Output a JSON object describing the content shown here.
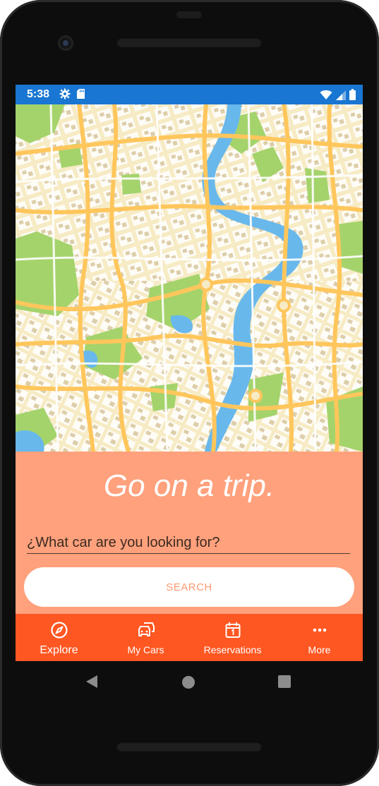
{
  "status_bar": {
    "time": "5:38",
    "background": "#1976d2",
    "icons_left": [
      "gear-icon",
      "sd-card-icon"
    ],
    "icons_right": [
      "wifi-icon",
      "cellular-signal-icon",
      "battery-icon"
    ]
  },
  "map": {
    "colors": {
      "land": "#f6ebc4",
      "park": "#a4d36c",
      "water": "#69b8ec",
      "road": "#ffc65c",
      "building": "#d9c9a6"
    }
  },
  "hero": {
    "title": "Go on a trip.",
    "background": "#ffa17c",
    "search": {
      "placeholder": "¿What car are you looking for?",
      "value": ""
    },
    "button_label": "SEARCH"
  },
  "bottom_nav": {
    "background": "#ff5722",
    "items": [
      {
        "label": "Explore",
        "icon": "compass-icon",
        "active": true
      },
      {
        "label": "My Cars",
        "icon": "cars-icon",
        "active": false
      },
      {
        "label": "Reservations",
        "icon": "calendar-icon",
        "active": false
      },
      {
        "label": "More",
        "icon": "more-dots-icon",
        "active": false
      }
    ]
  },
  "system_nav": {
    "icons": [
      "back-icon",
      "home-icon",
      "recents-icon"
    ]
  }
}
